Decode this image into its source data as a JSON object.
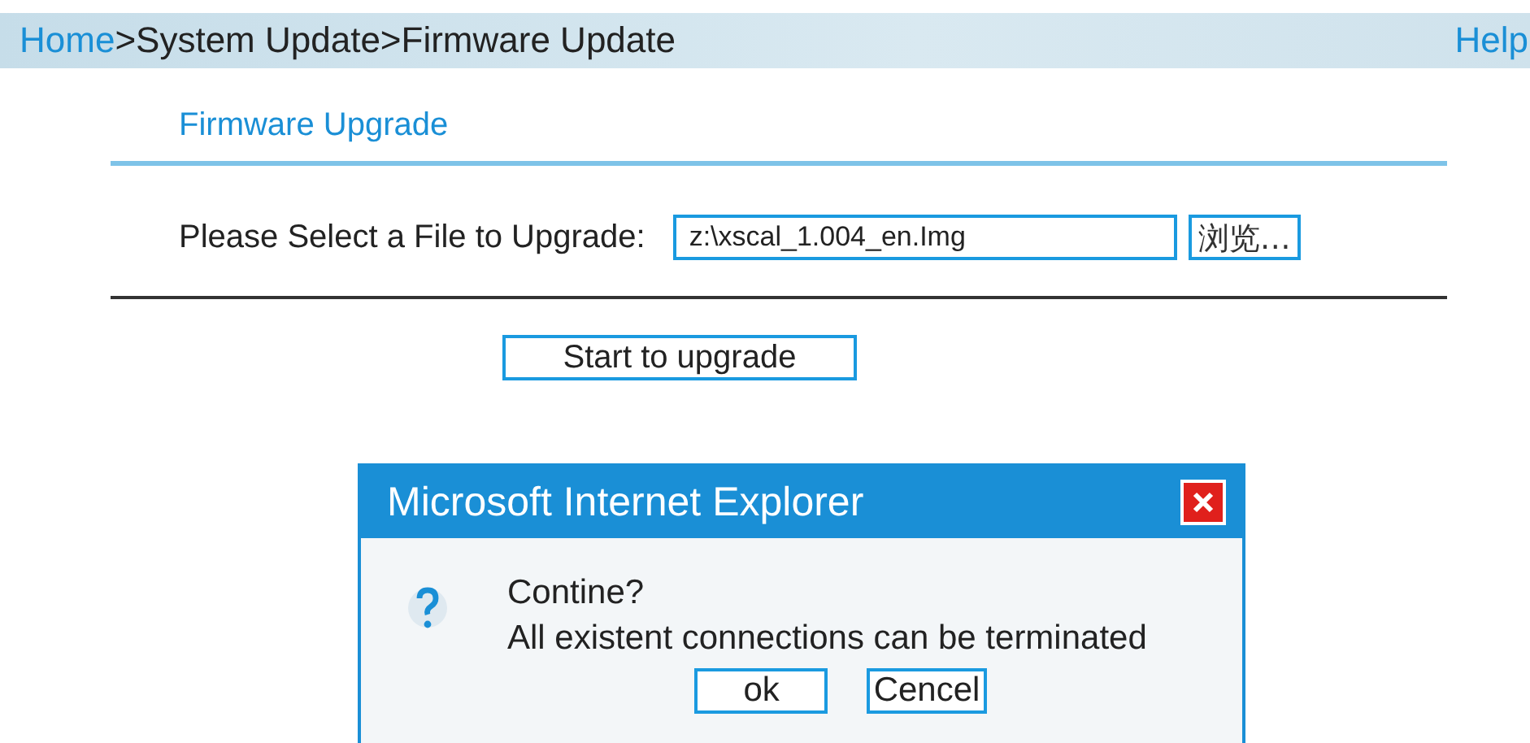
{
  "header": {
    "home_link": "Home",
    "trail": ">System Update>Firmware Update",
    "help_link": "Help"
  },
  "section": {
    "title": "Firmware Upgrade"
  },
  "file_row": {
    "label": "Please Select a File to Upgrade:",
    "value": "z:\\xscal_1.004_en.Img",
    "browse_button": "浏览…"
  },
  "start_button": "Start to upgrade",
  "dialog": {
    "title": "Microsoft Internet Explorer",
    "lines": [
      "Contine?",
      "All existent connections can be terminated"
    ],
    "buttons": [
      "ok",
      "Cencel"
    ]
  }
}
